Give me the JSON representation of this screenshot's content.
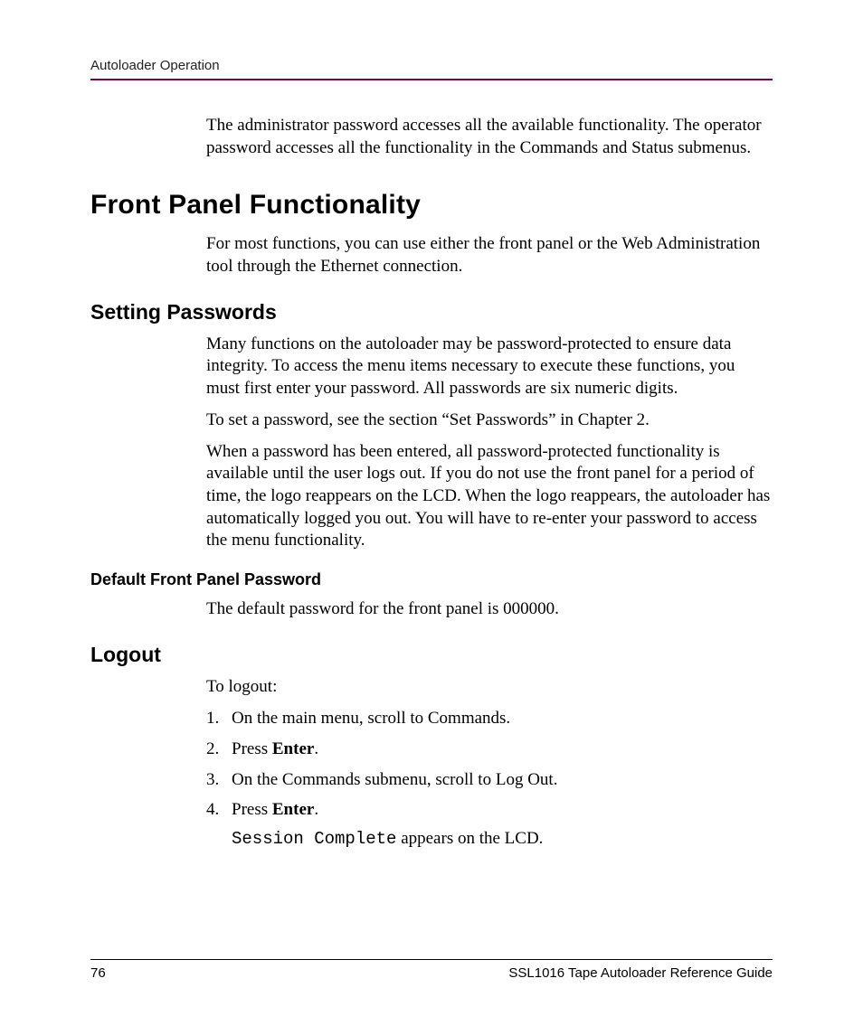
{
  "header": {
    "text": "Autoloader Operation"
  },
  "intro": {
    "p1": "The administrator password accesses all the available functionality. The operator password accesses all the functionality in the Commands and Status submenus."
  },
  "section1": {
    "title": "Front Panel Functionality",
    "p1": "For most functions, you can use either the front panel or the Web Administration tool through the Ethernet connection."
  },
  "section2": {
    "title": "Setting Passwords",
    "p1": "Many functions on the autoloader may be password-protected to ensure data integrity. To access the menu items necessary to execute these functions, you must first enter your password. All passwords are six numeric digits.",
    "p2": "To set a password, see the section “Set Passwords” in Chapter 2.",
    "p3": "When a password has been entered, all password-protected functionality is available until the user logs out. If you do not use the front panel for a period of time, the logo reappears on the LCD. When the logo reappears, the autoloader has automatically logged you out. You will have to re-enter your password to access the menu functionality."
  },
  "section3": {
    "title": "Default Front Panel Password",
    "p1": "The default password for the front panel is 000000."
  },
  "section4": {
    "title": "Logout",
    "p1": "To logout:",
    "steps": {
      "s1": "On the main menu, scroll to Commands.",
      "s2a": "Press ",
      "s2b": "Enter",
      "s2c": ".",
      "s3": "On the Commands submenu, scroll to Log Out.",
      "s4a": "Press ",
      "s4b": "Enter",
      "s4c": "."
    },
    "note_a": "Session Complete",
    "note_b": " appears on the LCD."
  },
  "footer": {
    "page": "76",
    "doc": "SSL1016 Tape Autoloader Reference Guide"
  }
}
